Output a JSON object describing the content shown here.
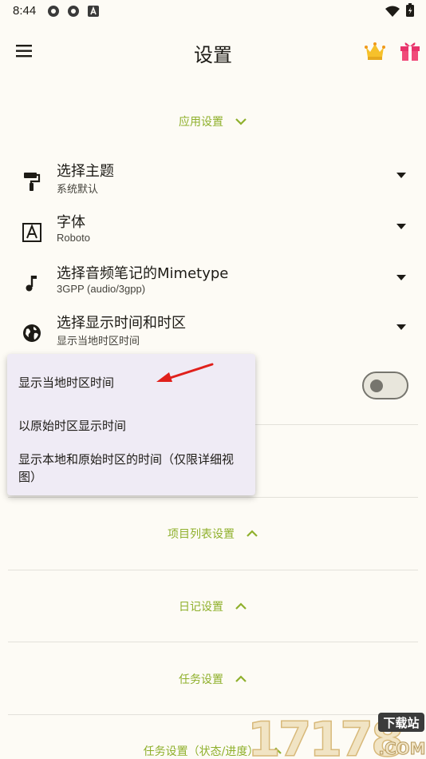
{
  "status_bar": {
    "time": "8:44"
  },
  "header": {
    "title": "设置"
  },
  "sections": {
    "app": {
      "label": "应用设置"
    },
    "project_list": {
      "label": "项目列表设置"
    },
    "diary": {
      "label": "日记设置"
    },
    "task": {
      "label": "任务设置"
    },
    "task_status": {
      "label": "任务设置（状态/进度）"
    }
  },
  "settings": [
    {
      "title": "选择主题",
      "subtitle": "系统默认",
      "icon": "paint-roller-icon"
    },
    {
      "title": "字体",
      "subtitle": "Roboto",
      "icon": "font-icon"
    },
    {
      "title": "选择音频笔记的Mimetype",
      "subtitle": "3GPP (audio/3gpp)",
      "icon": "music-note-icon"
    },
    {
      "title": "选择显示时间和时区",
      "subtitle": "显示当地时区时间",
      "icon": "globe-icon"
    }
  ],
  "dropdown_options": [
    "显示当地时区时间",
    "以原始时区显示时间",
    "显示本地和原始时区的时间（仅限详细视图）"
  ],
  "colors": {
    "accent": "#8fb02c",
    "background": "#fdfbf5",
    "popup": "#efebf5",
    "arrow": "#e0201b"
  },
  "watermark": {
    "text": "17178",
    "badge": "下载站",
    "domain": ".COM"
  }
}
